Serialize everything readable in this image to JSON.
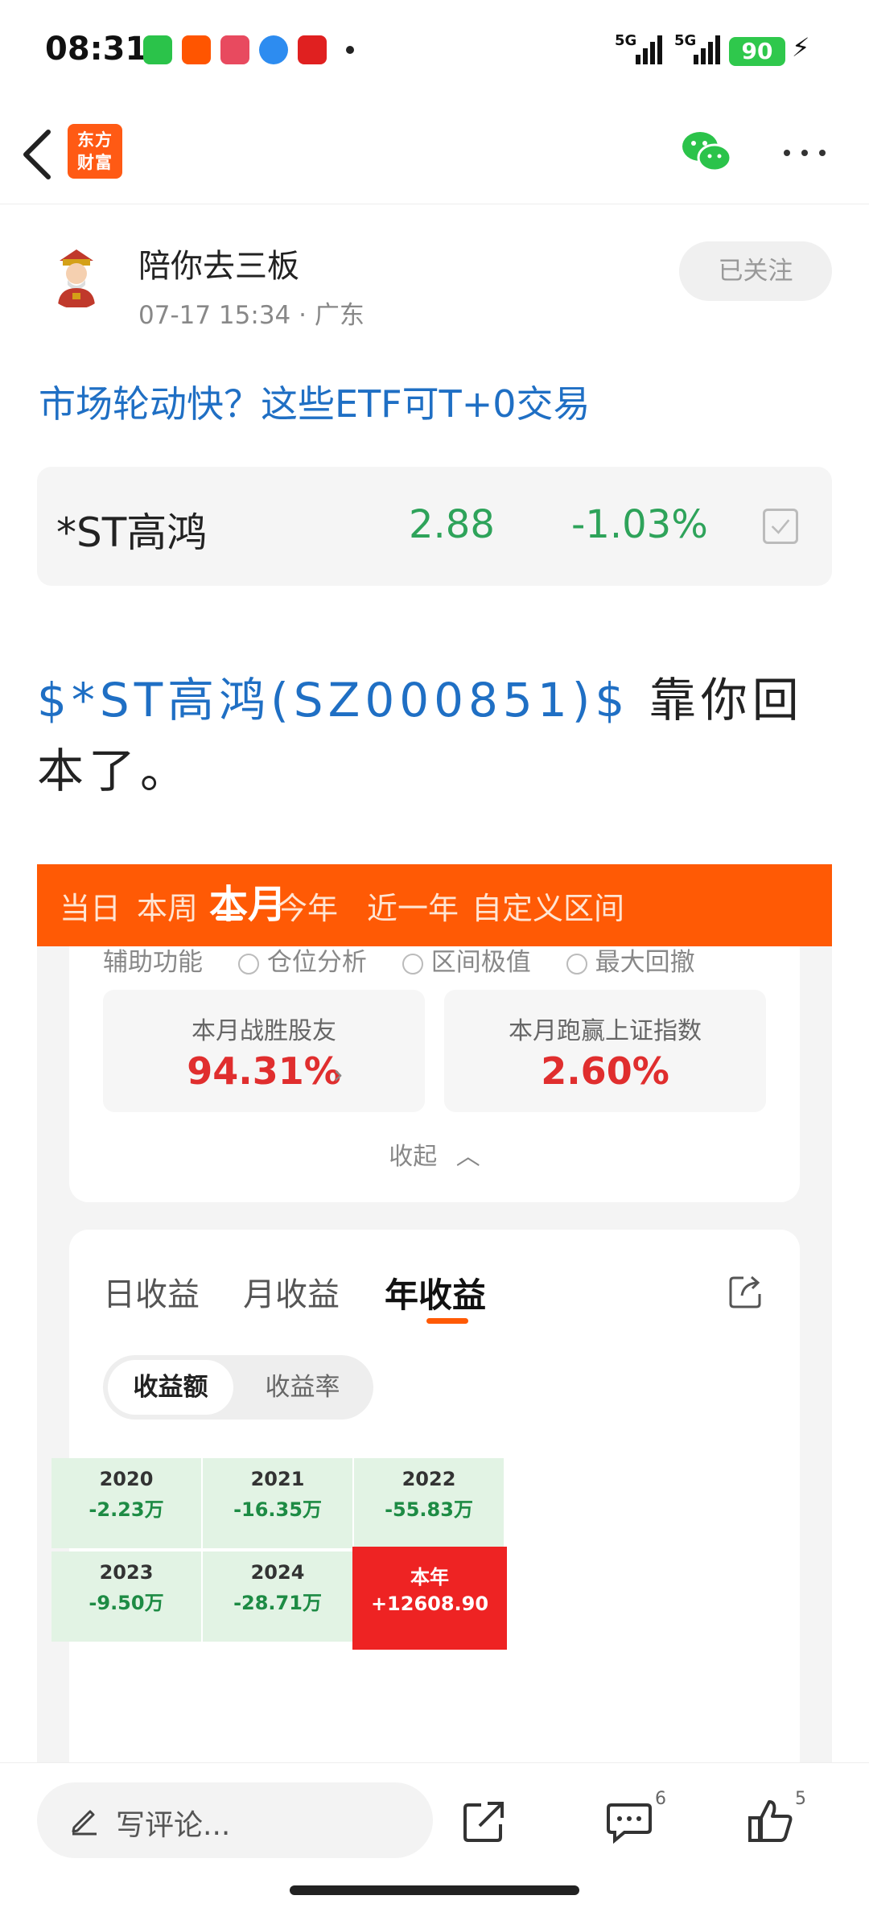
{
  "status": {
    "time": "08:31",
    "network1": "5G",
    "network2": "5G",
    "battery": "90"
  },
  "article": {
    "author": "陪你去三板",
    "meta": "07-17 15:34 · 广东",
    "follow_label": "已关注",
    "title": "市场轮动快？这些ETF可T+0交易",
    "stock": {
      "name": "*ST高鸿",
      "price": "2.88",
      "change": "-1.03%"
    },
    "body_ticker": "$*ST高鸿(SZ000851)$",
    "body_text": " 靠你回本了。"
  },
  "nav": {
    "logo_line1": "东方",
    "logo_line2": "财富"
  },
  "screenshot": {
    "period_tabs": [
      "当日",
      "本周",
      "本月",
      "今年",
      "近一年",
      "自定义区间"
    ],
    "active_period": "本月",
    "aux_label": "辅助功能",
    "aux_options": [
      "仓位分析",
      "区间极值",
      "最大回撤"
    ],
    "stat1_label": "本月战胜股友",
    "stat1_value": "94.31%",
    "stat2_label": "本月跑赢上证指数",
    "stat2_value": "2.60%",
    "collapse_label": "收起",
    "return_tabs": [
      "日收益",
      "月收益",
      "年收益"
    ],
    "active_return_tab": "年收益",
    "seg_options": [
      "收益额",
      "收益率"
    ],
    "years": [
      {
        "year": "2020",
        "amount": "-2.23万"
      },
      {
        "year": "2021",
        "amount": "-16.35万"
      },
      {
        "year": "2022",
        "amount": "-55.83万"
      },
      {
        "year": "2023",
        "amount": "-9.50万"
      },
      {
        "year": "2024",
        "amount": "-28.71万"
      },
      {
        "year": "本年",
        "amount": "+12608.90"
      }
    ]
  },
  "bottom": {
    "comment_placeholder": "写评论...",
    "comment_count": "6",
    "like_count": "5"
  },
  "colors": {
    "brand_orange": "#ff5a05",
    "link_blue": "#1f6fc4",
    "down_green": "#2ea35a",
    "up_red": "#ee2323"
  }
}
